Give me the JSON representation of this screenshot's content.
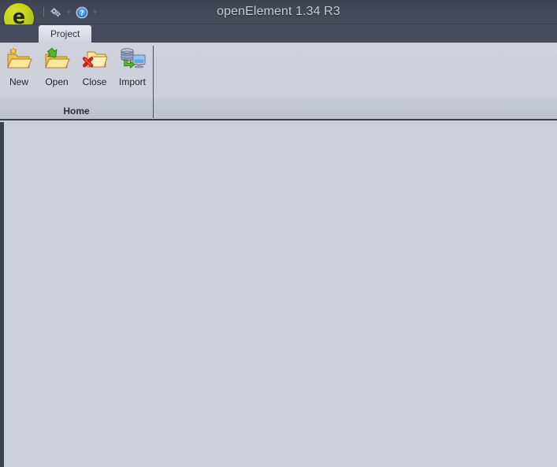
{
  "window": {
    "title": "openElement 1.34 R3",
    "logo_icon": "openelement-logo-icon",
    "logo_glyph": "e"
  },
  "quick_access_toolbar": {
    "separator": "|",
    "items": [
      {
        "icon": "gears-settings-icon",
        "label": "Settings"
      },
      {
        "icon": "chevron-down-icon",
        "glyph": "▼",
        "label": "Customize Quick Access Toolbar"
      },
      {
        "icon": "help-question-icon",
        "label": "Help"
      },
      {
        "icon": "chevron-down-icon",
        "glyph": "▼",
        "label": "Help options"
      }
    ]
  },
  "tabs": [
    {
      "label": "Project",
      "selected": true
    }
  ],
  "ribbon": {
    "groups": [
      {
        "title": "Home",
        "buttons": [
          {
            "label": "New",
            "icon": "folder-new-icon"
          },
          {
            "label": "Open",
            "icon": "folder-open-icon"
          },
          {
            "label": "Close",
            "icon": "folder-close-icon"
          },
          {
            "label": "Import",
            "icon": "database-import-icon"
          }
        ]
      }
    ]
  },
  "workspace": {
    "content": ""
  },
  "colors": {
    "titlebar": "#434757",
    "tabstrip": "#474b5b",
    "ribbon_body": "#cdcfda",
    "workspace": "#cdcfda",
    "border_dark": "#3b3f4e",
    "logo_green": "#c3d618",
    "title_text": "#c9cbd8",
    "folder_yellow": "#f7e07a"
  }
}
